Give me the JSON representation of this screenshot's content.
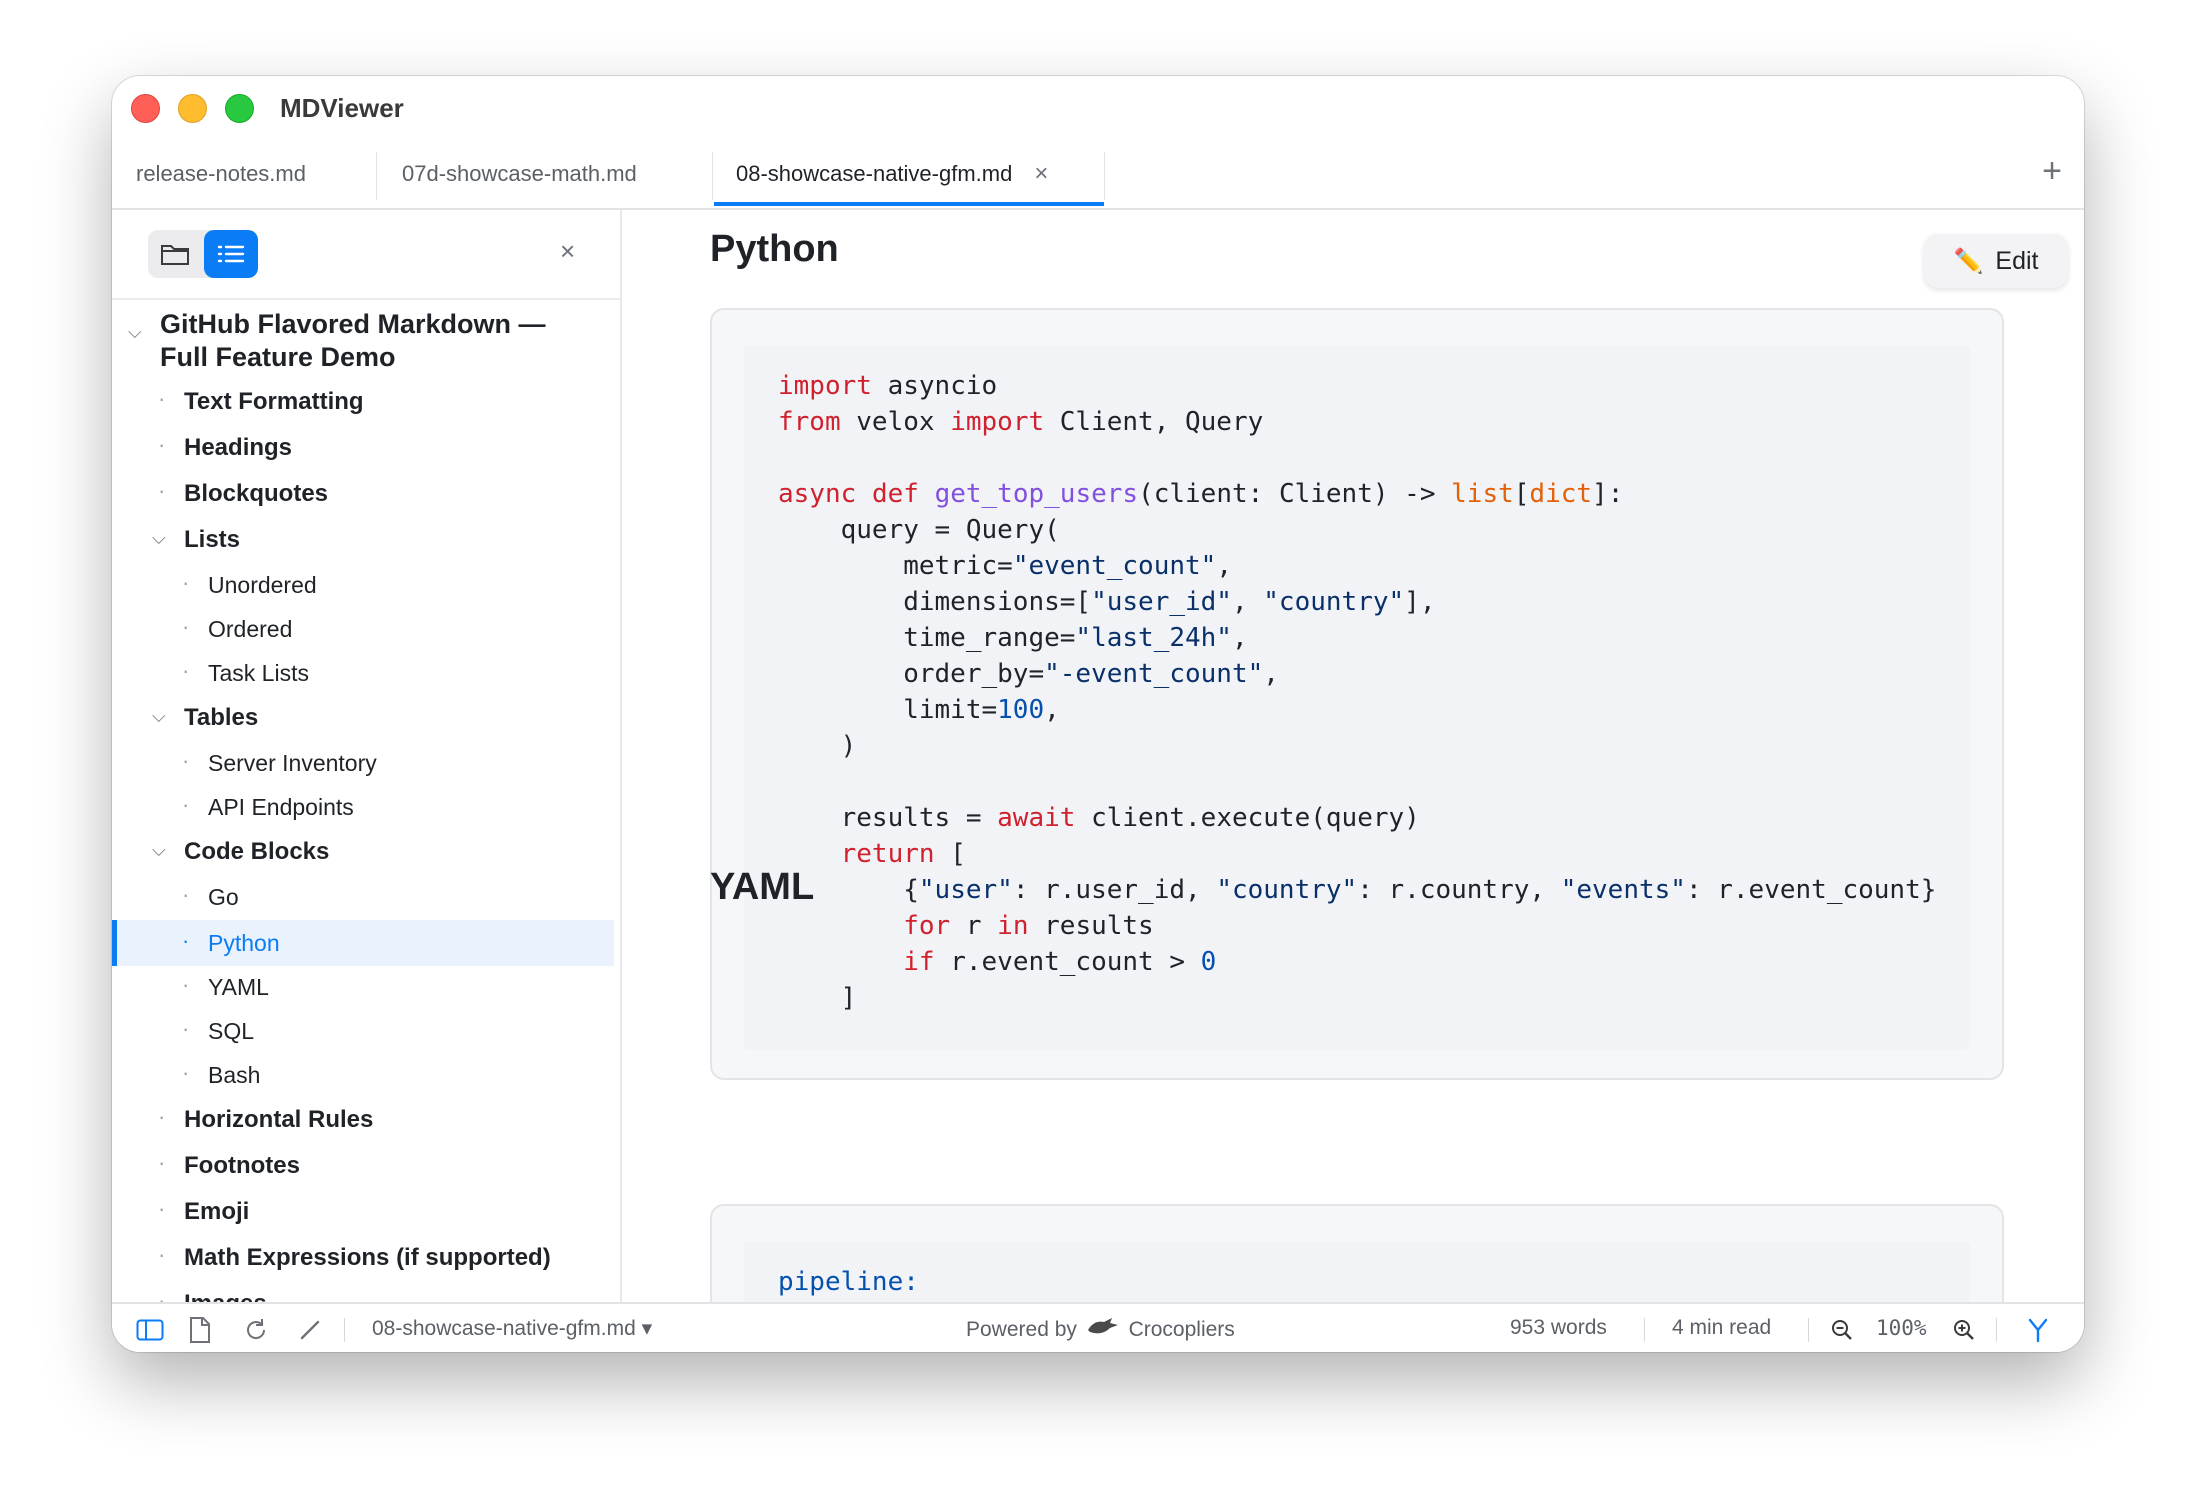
{
  "app": {
    "title": "MDViewer"
  },
  "tabs": [
    {
      "label": "release-notes.md"
    },
    {
      "label": "07d-showcase-math.md"
    },
    {
      "label": "08-showcase-native-gfm.md",
      "active": true,
      "close": "×"
    }
  ],
  "tab_add": "+",
  "sidebar": {
    "close": "×",
    "toc_title": "GitHub Flavored Markdown — Full Feature Demo",
    "items": [
      {
        "label": "Text Formatting"
      },
      {
        "label": "Headings"
      },
      {
        "label": "Blockquotes"
      },
      {
        "label": "Lists"
      },
      {
        "label": "Unordered"
      },
      {
        "label": "Ordered"
      },
      {
        "label": "Task Lists"
      },
      {
        "label": "Tables"
      },
      {
        "label": "Server Inventory"
      },
      {
        "label": "API Endpoints"
      },
      {
        "label": "Code Blocks"
      },
      {
        "label": "Go"
      },
      {
        "label": "Python",
        "active": true
      },
      {
        "label": "YAML"
      },
      {
        "label": "SQL"
      },
      {
        "label": "Bash"
      },
      {
        "label": "Horizontal Rules"
      },
      {
        "label": "Footnotes"
      },
      {
        "label": "Emoji"
      },
      {
        "label": "Math Expressions (if supported)"
      },
      {
        "label": "Images"
      }
    ]
  },
  "content": {
    "edit_label": "Edit",
    "section1_heading": "Python",
    "section2_heading": "YAML",
    "python_code": [
      "import asyncio",
      "from velox import Client, Query",
      "",
      "async def get_top_users(client: Client) -> list[dict]:",
      "    query = Query(",
      "        metric=\"event_count\",",
      "        dimensions=[\"user_id\", \"country\"],",
      "        time_range=\"last_24h\",",
      "        order_by=\"-event_count\",",
      "        limit=100,",
      "    )",
      "",
      "    results = await client.execute(query)",
      "    return [",
      "        {\"user\": r.user_id, \"country\": r.country, \"events\": r.event_count}",
      "        for r in results",
      "        if r.event_count > 0",
      "    ]"
    ],
    "yaml_code_first_line": "pipeline:"
  },
  "statusbar": {
    "filename": "08-showcase-native-gfm.md",
    "filename_caret": "▾",
    "powered_by": "Powered by",
    "brand": "Crocopliers",
    "words": "953 words",
    "read_time": "4 min read",
    "zoom": "100%"
  },
  "colors": {
    "accent": "#0a7cf6",
    "keyword": "#cf222e",
    "function": "#8250df",
    "string": "#0a3069",
    "builtin": "#e36209",
    "number": "#0550ae"
  }
}
